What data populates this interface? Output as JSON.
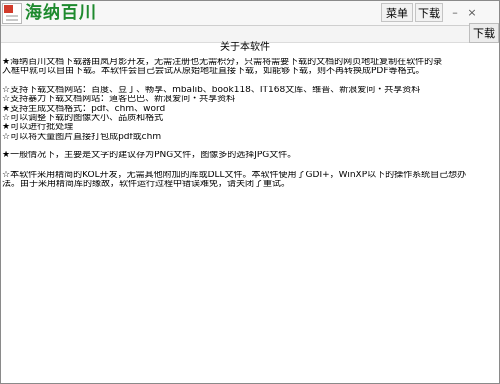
{
  "app": {
    "title": "海纳百川"
  },
  "toolbar": {
    "menu_label": "菜单",
    "download_label": "下载",
    "minimize_glyph": "–",
    "close_glyph": "×"
  },
  "tabs": {
    "download_tab_label": "下载"
  },
  "about": {
    "title": "关于本软件",
    "intro_line1": "★海纳百川文档下载器由岚月影开发，无需注册也无需积分，只需将需要下载的文档的网页地址复制在软件的录",
    "intro_line2": "入框中就可以自由下载。本软件会自己尝试从原始地址直接下载，如能够下载，则不再转换成PDF等格式。",
    "site_support": "☆支持下载文档网站：百度、豆丁、畅享、mbalib、book118、IT168文库、维普、新浪爱问・共享资料",
    "violent_support": "☆支持暴力下载文档网站：道客巴巴、新浪爱问・共享资料",
    "formats": "★支持生成文档格式：pdf、chm、word",
    "adjust": "☆可以调整下载的图像大小、品质和格式",
    "batch": "★可以进行批处理",
    "pack": "☆可以将大量图片直接打包成pdf或chm",
    "general_tip": "★一般情况下，主要是文字的建议存为PNG文件，图像多的选择JPG文件。",
    "kol_line1": "☆本软件采用精简的KOL开发，无需其他附加的库或DLL文件。本软件使用了GDI+，WinXP以下的操作系统自己想办",
    "kol_line2": "法。由于采用精简库的缘故，软件运行过程中错误难免，请关闭了重试。"
  }
}
